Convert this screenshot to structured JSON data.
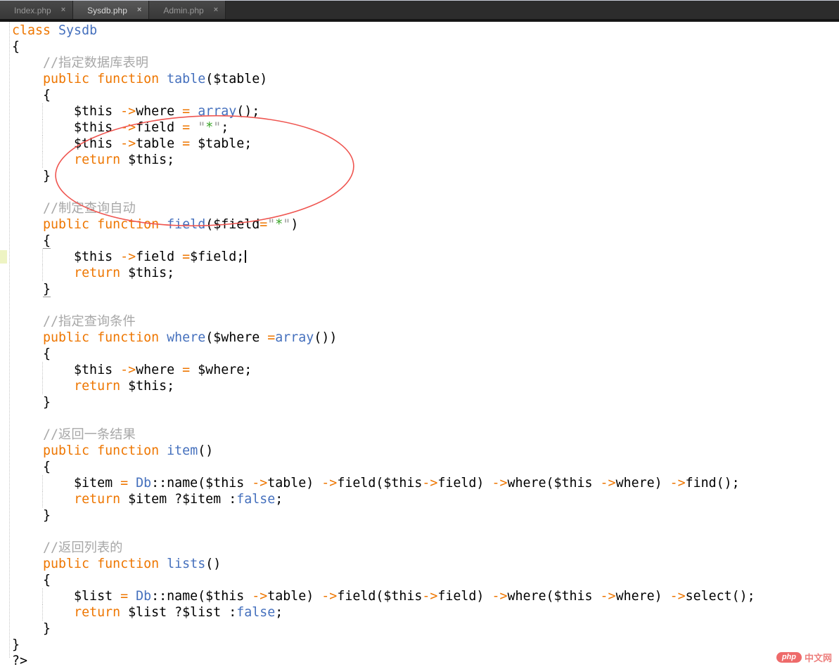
{
  "window": {
    "tabs": [
      {
        "label": "Index.php",
        "active": false
      },
      {
        "label": "Sysdb.php",
        "active": true
      },
      {
        "label": "Admin.php",
        "active": false
      }
    ],
    "close_glyph": "×"
  },
  "editor": {
    "language": "php",
    "lines": [
      {
        "t": [
          [
            "k",
            "class"
          ],
          [
            "v",
            " "
          ],
          [
            "i",
            "Sysdb"
          ]
        ]
      },
      {
        "t": [
          [
            "v",
            "{"
          ]
        ]
      },
      {
        "t": [
          [
            "v",
            "    "
          ],
          [
            "c",
            "//指定数据库表明"
          ]
        ]
      },
      {
        "t": [
          [
            "v",
            "    "
          ],
          [
            "k",
            "public"
          ],
          [
            "v",
            " "
          ],
          [
            "k",
            "function"
          ],
          [
            "v",
            " "
          ],
          [
            "i",
            "table"
          ],
          [
            "v",
            "($table)"
          ]
        ]
      },
      {
        "t": [
          [
            "v",
            "    {"
          ]
        ]
      },
      {
        "g": true,
        "t": [
          [
            "v",
            "        $this "
          ],
          [
            "k",
            "->"
          ],
          [
            "v",
            "where "
          ],
          [
            "k",
            "="
          ],
          [
            "v",
            " "
          ],
          [
            "i",
            "array"
          ],
          [
            "v",
            "();"
          ]
        ]
      },
      {
        "g": true,
        "t": [
          [
            "v",
            "        $this "
          ],
          [
            "k",
            "->"
          ],
          [
            "v",
            "field "
          ],
          [
            "k",
            "="
          ],
          [
            "v",
            " "
          ],
          [
            "q",
            "\""
          ],
          [
            "s",
            "*"
          ],
          [
            "q",
            "\""
          ],
          [
            "v",
            ";"
          ]
        ]
      },
      {
        "g": true,
        "t": [
          [
            "v",
            "        $this "
          ],
          [
            "k",
            "->"
          ],
          [
            "v",
            "table "
          ],
          [
            "k",
            "="
          ],
          [
            "v",
            " $table;"
          ]
        ]
      },
      {
        "g": true,
        "t": [
          [
            "v",
            "        "
          ],
          [
            "k",
            "return"
          ],
          [
            "v",
            " $this;"
          ]
        ]
      },
      {
        "t": [
          [
            "v",
            "    }"
          ]
        ]
      },
      {
        "t": []
      },
      {
        "t": [
          [
            "v",
            "    "
          ],
          [
            "c",
            "//制定查询自动"
          ]
        ]
      },
      {
        "t": [
          [
            "v",
            "    "
          ],
          [
            "k",
            "public"
          ],
          [
            "v",
            " "
          ],
          [
            "k",
            "function"
          ],
          [
            "v",
            " "
          ],
          [
            "i",
            "field"
          ],
          [
            "v",
            "($field"
          ],
          [
            "k",
            "="
          ],
          [
            "q",
            "\""
          ],
          [
            "s",
            "*"
          ],
          [
            "q",
            "\""
          ],
          [
            "v",
            ")"
          ]
        ]
      },
      {
        "t": [
          [
            "v",
            "    "
          ],
          [
            "vu",
            "{"
          ]
        ]
      },
      {
        "g": true,
        "m": true,
        "t": [
          [
            "v",
            "        $this "
          ],
          [
            "k",
            "->"
          ],
          [
            "v",
            "field "
          ],
          [
            "k",
            "="
          ],
          [
            "v",
            "$field;"
          ],
          [
            "caret",
            ""
          ]
        ]
      },
      {
        "g": true,
        "t": [
          [
            "v",
            "        "
          ],
          [
            "k",
            "return"
          ],
          [
            "v",
            " $this;"
          ]
        ]
      },
      {
        "t": [
          [
            "v",
            "    "
          ],
          [
            "vu",
            "}"
          ]
        ]
      },
      {
        "t": []
      },
      {
        "t": [
          [
            "v",
            "    "
          ],
          [
            "c",
            "//指定查询条件"
          ]
        ]
      },
      {
        "t": [
          [
            "v",
            "    "
          ],
          [
            "k",
            "public"
          ],
          [
            "v",
            " "
          ],
          [
            "k",
            "function"
          ],
          [
            "v",
            " "
          ],
          [
            "i",
            "where"
          ],
          [
            "v",
            "($where "
          ],
          [
            "k",
            "="
          ],
          [
            "i",
            "array"
          ],
          [
            "v",
            "())"
          ]
        ]
      },
      {
        "t": [
          [
            "v",
            "    {"
          ]
        ]
      },
      {
        "g": true,
        "t": [
          [
            "v",
            "        $this "
          ],
          [
            "k",
            "->"
          ],
          [
            "v",
            "where "
          ],
          [
            "k",
            "="
          ],
          [
            "v",
            " $where;"
          ]
        ]
      },
      {
        "g": true,
        "t": [
          [
            "v",
            "        "
          ],
          [
            "k",
            "return"
          ],
          [
            "v",
            " $this;"
          ]
        ]
      },
      {
        "t": [
          [
            "v",
            "    }"
          ]
        ]
      },
      {
        "t": []
      },
      {
        "t": [
          [
            "v",
            "    "
          ],
          [
            "c",
            "//返回一条结果"
          ]
        ]
      },
      {
        "t": [
          [
            "v",
            "    "
          ],
          [
            "k",
            "public"
          ],
          [
            "v",
            " "
          ],
          [
            "k",
            "function"
          ],
          [
            "v",
            " "
          ],
          [
            "i",
            "item"
          ],
          [
            "v",
            "()"
          ]
        ]
      },
      {
        "t": [
          [
            "v",
            "    {"
          ]
        ]
      },
      {
        "g": true,
        "t": [
          [
            "v",
            "        $item "
          ],
          [
            "k",
            "="
          ],
          [
            "v",
            " "
          ],
          [
            "i",
            "Db"
          ],
          [
            "v",
            "::name($this "
          ],
          [
            "k",
            "->"
          ],
          [
            "v",
            "table) "
          ],
          [
            "k",
            "->"
          ],
          [
            "v",
            "field($this"
          ],
          [
            "k",
            "->"
          ],
          [
            "v",
            "field) "
          ],
          [
            "k",
            "->"
          ],
          [
            "v",
            "where($this "
          ],
          [
            "k",
            "->"
          ],
          [
            "v",
            "where) "
          ],
          [
            "k",
            "->"
          ],
          [
            "v",
            "find();"
          ]
        ]
      },
      {
        "g": true,
        "t": [
          [
            "v",
            "        "
          ],
          [
            "k",
            "return"
          ],
          [
            "v",
            " $item ?$item :"
          ],
          [
            "i",
            "false"
          ],
          [
            "v",
            ";"
          ]
        ]
      },
      {
        "t": [
          [
            "v",
            "    }"
          ]
        ]
      },
      {
        "t": []
      },
      {
        "t": [
          [
            "v",
            "    "
          ],
          [
            "c",
            "//返回列表的"
          ]
        ]
      },
      {
        "t": [
          [
            "v",
            "    "
          ],
          [
            "k",
            "public"
          ],
          [
            "v",
            " "
          ],
          [
            "k",
            "function"
          ],
          [
            "v",
            " "
          ],
          [
            "i",
            "lists"
          ],
          [
            "v",
            "()"
          ]
        ]
      },
      {
        "t": [
          [
            "v",
            "    {"
          ]
        ]
      },
      {
        "g": true,
        "t": [
          [
            "v",
            "        $list "
          ],
          [
            "k",
            "="
          ],
          [
            "v",
            " "
          ],
          [
            "i",
            "Db"
          ],
          [
            "v",
            "::name($this "
          ],
          [
            "k",
            "->"
          ],
          [
            "v",
            "table) "
          ],
          [
            "k",
            "->"
          ],
          [
            "v",
            "field($this"
          ],
          [
            "k",
            "->"
          ],
          [
            "v",
            "field) "
          ],
          [
            "k",
            "->"
          ],
          [
            "v",
            "where($this "
          ],
          [
            "k",
            "->"
          ],
          [
            "v",
            "where) "
          ],
          [
            "k",
            "->"
          ],
          [
            "v",
            "select();"
          ]
        ]
      },
      {
        "g": true,
        "t": [
          [
            "v",
            "        "
          ],
          [
            "k",
            "return"
          ],
          [
            "v",
            " $list ?$list :"
          ],
          [
            "i",
            "false"
          ],
          [
            "v",
            ";"
          ]
        ]
      },
      {
        "t": [
          [
            "v",
            "    }"
          ]
        ]
      },
      {
        "t": [
          [
            "v",
            "}"
          ]
        ]
      },
      {
        "t": [
          [
            "v",
            "?>"
          ]
        ]
      }
    ]
  },
  "annotation": {
    "shape": "ellipse",
    "color": "#ef5550"
  },
  "watermark": {
    "badge": "php",
    "text": "中文网"
  },
  "colors": {
    "keyword_operator": "#ee7600",
    "identifier": "#4570bd",
    "comment": "#a8a8a8",
    "string_quote": "#9e9e9e",
    "string_content": "#37a424",
    "plain_code": "#000000",
    "changed_line_marker": "#eef4c3",
    "annotation_red": "#ef5550",
    "tabbar_bg": "#2c2c2c",
    "active_tab_text": "#d9d9d9",
    "inactive_tab_text": "#979797"
  }
}
